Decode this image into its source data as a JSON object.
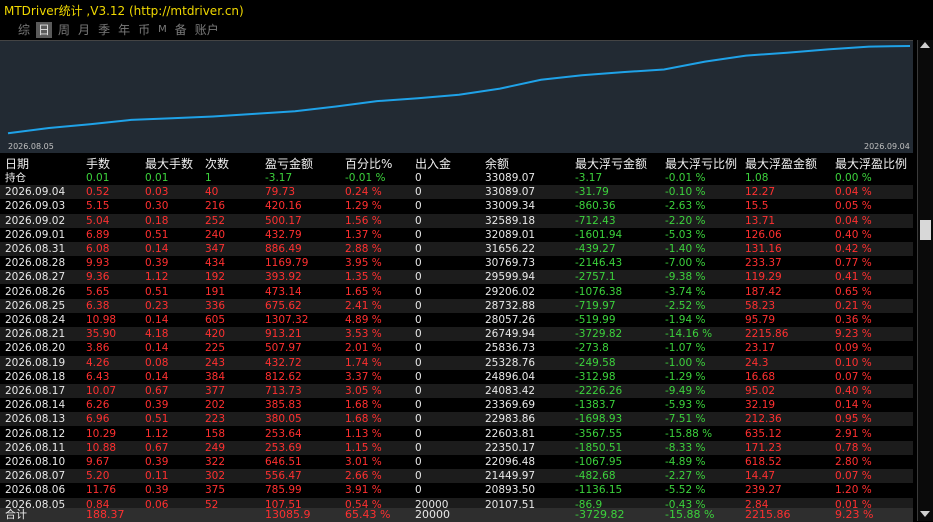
{
  "title": "MTDriver统计 ,V3.12 (http://mtdriver.cn)",
  "tabs": [
    {
      "label": "综",
      "active": false
    },
    {
      "label": "日",
      "active": true
    },
    {
      "label": "周",
      "active": false
    },
    {
      "label": "月",
      "active": false
    },
    {
      "label": "季",
      "active": false
    },
    {
      "label": "年",
      "active": false
    },
    {
      "label": "币",
      "active": false
    },
    {
      "label": "M",
      "active": false
    },
    {
      "label": "备",
      "active": false
    },
    {
      "label": "账户",
      "active": false
    }
  ],
  "chart_data": {
    "type": "line",
    "x": [
      "2026.08.05",
      "2026.08.06",
      "2026.08.07",
      "2026.08.10",
      "2026.08.11",
      "2026.08.12",
      "2026.08.13",
      "2026.08.14",
      "2026.08.17",
      "2026.08.18",
      "2026.08.19",
      "2026.08.20",
      "2026.08.21",
      "2026.08.24",
      "2026.08.25",
      "2026.08.26",
      "2026.08.27",
      "2026.08.28",
      "2026.08.31",
      "2026.09.01",
      "2026.09.02",
      "2026.09.03",
      "2026.09.04"
    ],
    "values": [
      20107.51,
      20893.5,
      21449.97,
      22096.48,
      22350.17,
      22603.81,
      22983.86,
      23369.69,
      24083.42,
      24896.04,
      25328.76,
      25836.73,
      26749.94,
      28057.26,
      28732.88,
      29206.02,
      29599.94,
      30769.73,
      31656.22,
      32089.01,
      32589.18,
      33009.34,
      33089.07
    ],
    "x_start_label": "2026.08.05",
    "x_end_label": "2026.09.04",
    "line_color": "#1fa2e8",
    "background": "#222a33"
  },
  "headers": [
    "日期",
    "手数",
    "最大手数",
    "次数",
    "盈亏金额",
    "百分比%",
    "出入金",
    "余额",
    "最大浮亏金额",
    "最大浮亏比例",
    "最大浮盈金额",
    "最大浮盈比例"
  ],
  "holding": [
    "持仓",
    "0.01",
    "0.01",
    "1",
    "-3.17",
    "-0.01 %",
    "0",
    "33089.07",
    "-3.17",
    "-0.01 %",
    "1.08",
    "0.00 %"
  ],
  "rows": [
    [
      "2026.09.04",
      "0.52",
      "0.03",
      "40",
      "79.73",
      "0.24 %",
      "0",
      "33089.07",
      "-31.79",
      "-0.10 %",
      "12.27",
      "0.04 %"
    ],
    [
      "2026.09.03",
      "5.15",
      "0.30",
      "216",
      "420.16",
      "1.29 %",
      "0",
      "33009.34",
      "-860.36",
      "-2.63 %",
      "15.5",
      "0.05 %"
    ],
    [
      "2026.09.02",
      "5.04",
      "0.18",
      "252",
      "500.17",
      "1.56 %",
      "0",
      "32589.18",
      "-712.43",
      "-2.20 %",
      "13.71",
      "0.04 %"
    ],
    [
      "2026.09.01",
      "6.89",
      "0.51",
      "240",
      "432.79",
      "1.37 %",
      "0",
      "32089.01",
      "-1601.94",
      "-5.03 %",
      "126.06",
      "0.40 %"
    ],
    [
      "2026.08.31",
      "6.08",
      "0.14",
      "347",
      "886.49",
      "2.88 %",
      "0",
      "31656.22",
      "-439.27",
      "-1.40 %",
      "131.16",
      "0.42 %"
    ],
    [
      "2026.08.28",
      "9.93",
      "0.39",
      "434",
      "1169.79",
      "3.95 %",
      "0",
      "30769.73",
      "-2146.43",
      "-7.00 %",
      "233.37",
      "0.77 %"
    ],
    [
      "2026.08.27",
      "9.36",
      "1.12",
      "192",
      "393.92",
      "1.35 %",
      "0",
      "29599.94",
      "-2757.1",
      "-9.38 %",
      "119.29",
      "0.41 %"
    ],
    [
      "2026.08.26",
      "5.65",
      "0.51",
      "191",
      "473.14",
      "1.65 %",
      "0",
      "29206.02",
      "-1076.38",
      "-3.74 %",
      "187.42",
      "0.65 %"
    ],
    [
      "2026.08.25",
      "6.38",
      "0.23",
      "336",
      "675.62",
      "2.41 %",
      "0",
      "28732.88",
      "-719.97",
      "-2.52 %",
      "58.23",
      "0.21 %"
    ],
    [
      "2026.08.24",
      "10.98",
      "0.14",
      "605",
      "1307.32",
      "4.89 %",
      "0",
      "28057.26",
      "-519.99",
      "-1.94 %",
      "95.79",
      "0.36 %"
    ],
    [
      "2026.08.21",
      "35.90",
      "4.18",
      "420",
      "913.21",
      "3.53 %",
      "0",
      "26749.94",
      "-3729.82",
      "-14.16 %",
      "2215.86",
      "9.23 %"
    ],
    [
      "2026.08.20",
      "3.86",
      "0.14",
      "225",
      "507.97",
      "2.01 %",
      "0",
      "25836.73",
      "-273.8",
      "-1.07 %",
      "23.17",
      "0.09 %"
    ],
    [
      "2026.08.19",
      "4.26",
      "0.08",
      "243",
      "432.72",
      "1.74 %",
      "0",
      "25328.76",
      "-249.58",
      "-1.00 %",
      "24.3",
      "0.10 %"
    ],
    [
      "2026.08.18",
      "6.43",
      "0.14",
      "384",
      "812.62",
      "3.37 %",
      "0",
      "24896.04",
      "-312.98",
      "-1.29 %",
      "16.68",
      "0.07 %"
    ],
    [
      "2026.08.17",
      "10.07",
      "0.67",
      "377",
      "713.73",
      "3.05 %",
      "0",
      "24083.42",
      "-2226.26",
      "-9.49 %",
      "95.02",
      "0.40 %"
    ],
    [
      "2026.08.14",
      "6.26",
      "0.39",
      "202",
      "385.83",
      "1.68 %",
      "0",
      "23369.69",
      "-1383.7",
      "-5.93 %",
      "32.19",
      "0.14 %"
    ],
    [
      "2026.08.13",
      "6.96",
      "0.51",
      "223",
      "380.05",
      "1.68 %",
      "0",
      "22983.86",
      "-1698.93",
      "-7.51 %",
      "212.36",
      "0.95 %"
    ],
    [
      "2026.08.12",
      "10.29",
      "1.12",
      "158",
      "253.64",
      "1.13 %",
      "0",
      "22603.81",
      "-3567.55",
      "-15.88 %",
      "635.12",
      "2.91 %"
    ],
    [
      "2026.08.11",
      "10.88",
      "0.67",
      "249",
      "253.69",
      "1.15 %",
      "0",
      "22350.17",
      "-1850.51",
      "-8.33 %",
      "171.23",
      "0.78 %"
    ],
    [
      "2026.08.10",
      "9.67",
      "0.39",
      "322",
      "646.51",
      "3.01 %",
      "0",
      "22096.48",
      "-1067.95",
      "-4.89 %",
      "618.52",
      "2.80 %"
    ],
    [
      "2026.08.07",
      "5.20",
      "0.11",
      "302",
      "556.47",
      "2.66 %",
      "0",
      "21449.97",
      "-482.68",
      "-2.27 %",
      "14.47",
      "0.07 %"
    ],
    [
      "2026.08.06",
      "11.76",
      "0.39",
      "375",
      "785.99",
      "3.91 %",
      "0",
      "20893.50",
      "-1136.15",
      "-5.52 %",
      "239.27",
      "1.20 %"
    ],
    [
      "2026.08.05",
      "0.84",
      "0.06",
      "52",
      "107.51",
      "0.54 %",
      "20000",
      "20107.51",
      "-86.9",
      "-0.43 %",
      "2.84",
      "0.01 %"
    ]
  ],
  "total": [
    "合计",
    "188.37",
    "",
    "",
    "13085.9",
    "65.43 %",
    "20000",
    "",
    "-3729.82",
    "-15.88 %",
    "2215.86",
    "9.23 %"
  ]
}
